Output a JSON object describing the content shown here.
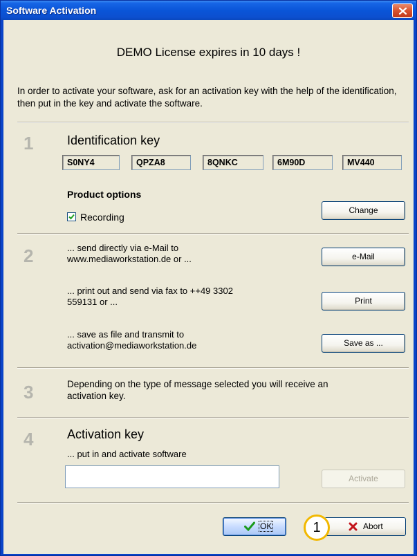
{
  "window": {
    "title": "Software Activation",
    "headline": "DEMO License expires in 10 days !",
    "intro": "In order to activate your software, ask for an activation key with the help of the identification, then put in the key and activate the software."
  },
  "step1": {
    "number": "1",
    "heading": "Identification key",
    "keys": [
      "S0NY4",
      "QPZA8",
      "8QNKC",
      "6M90D",
      "MV440"
    ],
    "product_options_label": "Product options",
    "recording_label": "Recording",
    "recording_checked": true,
    "change_label": "Change"
  },
  "step2": {
    "number": "2",
    "email_text_1": "... send directly via e-Mail to",
    "email_text_2": "www.mediaworkstation.de or ...",
    "email_label": "e-Mail",
    "fax_text_1": "... print out and send via fax to ++49 3302",
    "fax_text_2": "559131 or ...",
    "print_label": "Print",
    "file_text_1": "... save as file and transmit to",
    "file_text_2": "activation@mediaworkstation.de",
    "saveas_label": "Save as ..."
  },
  "step3": {
    "number": "3",
    "text_1": "Depending on the type of message selected you will receive an",
    "text_2": "activation key."
  },
  "step4": {
    "number": "4",
    "heading": "Activation key",
    "subtext": "... put in and activate software",
    "input_value": "",
    "activate_label": "Activate"
  },
  "footer": {
    "ok_label": "OK",
    "abort_label": "Abort",
    "callout_number": "1"
  },
  "colors": {
    "titlebar": "#0a55d8",
    "dialog_bg": "#ece9d8",
    "step_number": "#b5b5ad",
    "callout_border": "#f2b800"
  }
}
